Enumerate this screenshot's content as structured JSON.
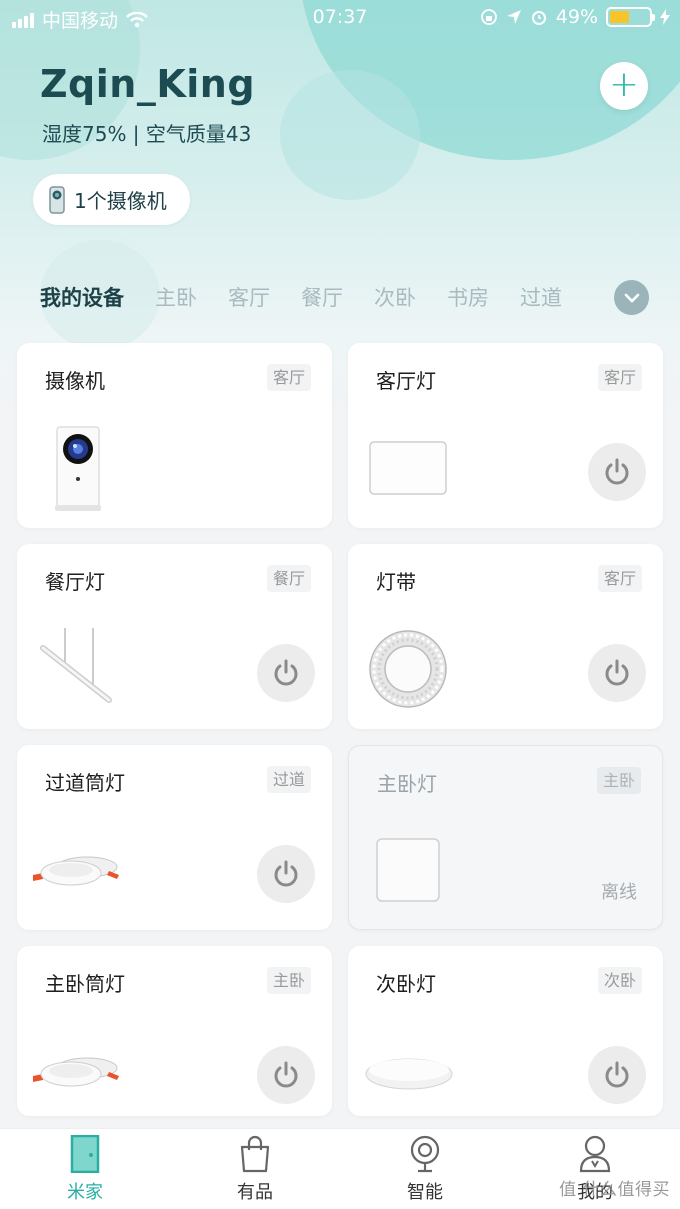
{
  "status_bar": {
    "carrier": "中国移动",
    "time": "07:37",
    "battery_percent": "49%",
    "battery_level": 0.49,
    "battery_color": "#f7c52a"
  },
  "header": {
    "username": "Zqin_King",
    "environment": "湿度75% | 空气质量43",
    "add_icon": "plus-icon",
    "camera_pill": "1个摄像机"
  },
  "tabs": [
    "我的设备",
    "主卧",
    "客厅",
    "餐厅",
    "次卧",
    "书房",
    "过道"
  ],
  "devices": [
    {
      "name": "摄像机",
      "room": "客厅",
      "has_power": false
    },
    {
      "name": "客厅灯",
      "room": "客厅",
      "has_power": true
    },
    {
      "name": "餐厅灯",
      "room": "餐厅",
      "has_power": true
    },
    {
      "name": "灯带",
      "room": "客厅",
      "has_power": true
    },
    {
      "name": "过道筒灯",
      "room": "过道",
      "has_power": true
    },
    {
      "name": "主卧灯",
      "room": "主卧",
      "has_power": false,
      "status": "离线"
    },
    {
      "name": "主卧筒灯",
      "room": "主卧",
      "has_power": true
    },
    {
      "name": "次卧灯",
      "room": "次卧",
      "has_power": true
    }
  ],
  "bottom_nav": [
    {
      "label": "米家",
      "icon": "door-icon",
      "active": true
    },
    {
      "label": "有品",
      "icon": "shopping-bag-icon",
      "active": false
    },
    {
      "label": "智能",
      "icon": "smart-camera-icon",
      "active": false
    },
    {
      "label": "我的",
      "icon": "profile-icon",
      "active": false
    }
  ],
  "watermark": "值 什么值得买",
  "accent_color": "#2aaea3"
}
